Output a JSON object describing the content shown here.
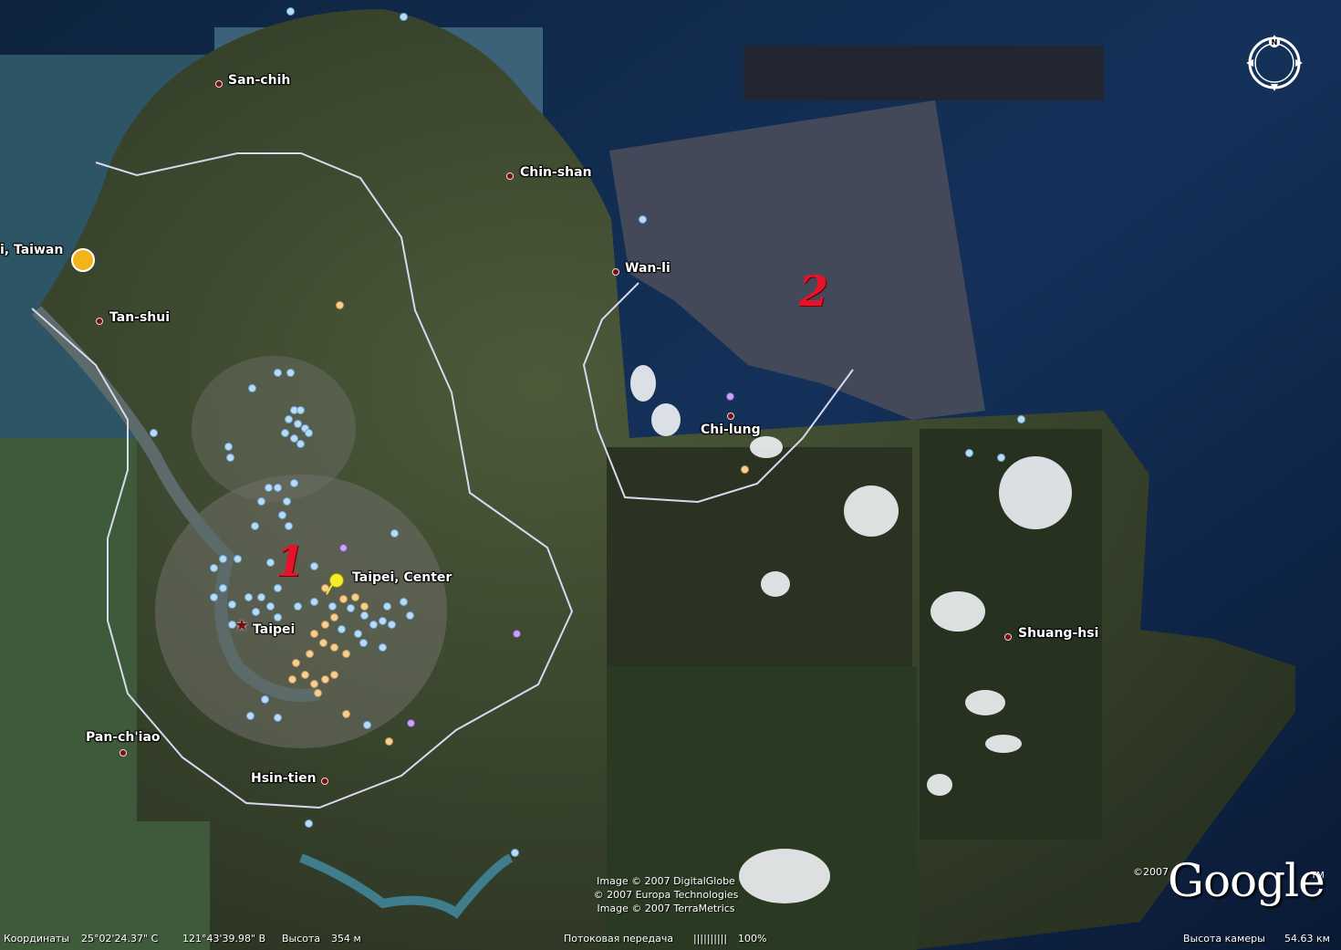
{
  "places": [
    {
      "name": "San-chih"
    },
    {
      "name": "Chin-shan"
    },
    {
      "name": "i, Taiwan"
    },
    {
      "name": "Tan-shui"
    },
    {
      "name": "Wan-li"
    },
    {
      "name": "Chi-lung"
    },
    {
      "name": "Taipei, Center"
    },
    {
      "name": "Taipei"
    },
    {
      "name": "Pan-ch'iao"
    },
    {
      "name": "Hsin-tien"
    },
    {
      "name": "Shuang-hsi"
    }
  ],
  "annotations": {
    "zone1": "1",
    "zone2": "2"
  },
  "credits": [
    "Image © 2007 DigitalGlobe",
    "© 2007 Europa Technologies",
    "Image © 2007 TerraMetrics"
  ],
  "brand": {
    "year": "©2007",
    "logo": "Google",
    "tm": "TM"
  },
  "compass": {
    "north_label": "N"
  },
  "status": {
    "coords_label": "Координаты",
    "lat": "25°02'24.37\" С",
    "lon": "121°43'39.98\" В",
    "elevation_label": "Высота",
    "elevation": "354 м",
    "streaming_label": "Потоковая передача",
    "streaming_bar": "||||||||||",
    "streaming_pct": "100%",
    "eye_alt_label": "Высота камеры",
    "eye_alt": "54.63 км"
  },
  "colors": {
    "ocean": "#0b1a33",
    "boundary": "#d8d8f0",
    "handwriting": "#e8112a",
    "pin_blue": "#b9dbf5",
    "pin_orange": "#f6cf97",
    "pin_purple": "#c9a4f2"
  }
}
